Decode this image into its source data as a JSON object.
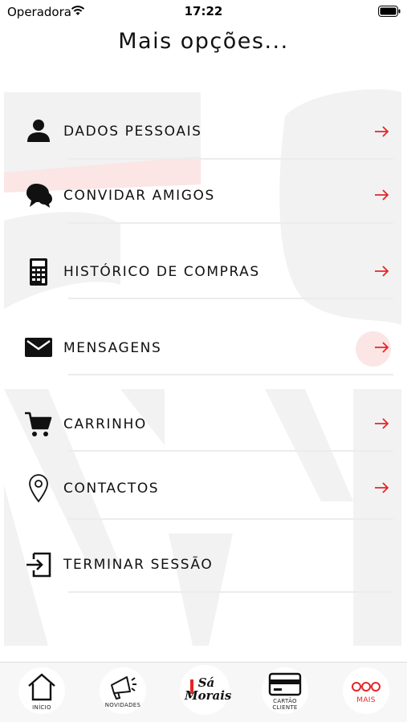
{
  "status_bar": {
    "carrier": "Operadora",
    "time": "17:22"
  },
  "header": {
    "title": "Mais opções..."
  },
  "menu": {
    "items": [
      {
        "label": "DADOS PESSOAIS",
        "icon": "user-icon"
      },
      {
        "label": "CONVIDAR AMIGOS",
        "icon": "chat-bubbles-icon"
      },
      {
        "label": "HISTÓRICO DE COMPRAS",
        "icon": "calculator-icon"
      },
      {
        "label": "MENSAGENS",
        "icon": "envelope-icon"
      },
      {
        "label": "CARRINHO",
        "icon": "cart-icon"
      },
      {
        "label": "CONTACTOS",
        "icon": "location-pin-icon"
      },
      {
        "label": "TERMINAR SESSÃO",
        "icon": "logout-icon"
      }
    ]
  },
  "tab_bar": {
    "tabs": [
      {
        "label": "INÍCIO",
        "icon": "home-icon"
      },
      {
        "label": "NOVIDADES",
        "icon": "megaphone-icon"
      },
      {
        "label": "Sá Morais",
        "icon": "brand-logo"
      },
      {
        "label": "CARTÃO CLIENTE",
        "label_line1": "CARTÃO",
        "label_line2": "CLIENTE",
        "icon": "card-icon"
      },
      {
        "label": "MAIS",
        "icon": "more-icon"
      }
    ]
  },
  "colors": {
    "accent": "#e52629",
    "text": "#111111",
    "tab_bar_bg": "#f7f7f7",
    "watermark": "#f1f1f1"
  }
}
